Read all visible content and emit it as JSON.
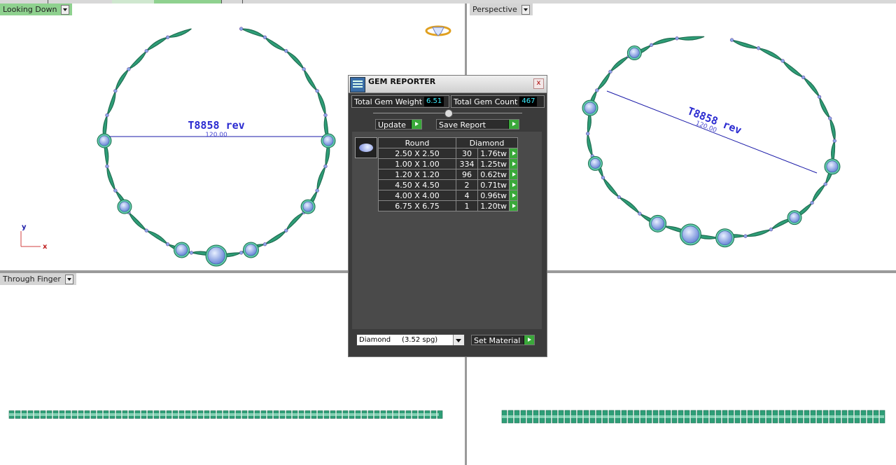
{
  "viewports": {
    "top_left": {
      "label": "Looking Down"
    },
    "top_right": {
      "label": "Perspective"
    },
    "bottom_left": {
      "label": "Through Finger"
    }
  },
  "annotation": {
    "name": "T8858 rev",
    "dimension": "120.00"
  },
  "axis": {
    "y": "y",
    "x": "x"
  },
  "gem_reporter": {
    "title": "GEM REPORTER",
    "close": "x",
    "total_weight_label": "Total Gem Weight",
    "total_weight_value": "6.51",
    "total_count_label": "Total Gem Count",
    "total_count_value": "467",
    "update_label": "Update",
    "save_report_label": "Save Report",
    "table_headers": {
      "shape": "Round",
      "material": "Diamond"
    },
    "rows": [
      {
        "size": "2.50 X 2.50",
        "count": "30",
        "carat": "1.76tw"
      },
      {
        "size": "1.00 X 1.00",
        "count": "334",
        "carat": "1.25tw"
      },
      {
        "size": "1.20 X 1.20",
        "count": "96",
        "carat": "0.62tw"
      },
      {
        "size": "4.50 X 4.50",
        "count": "2",
        "carat": "0.71tw"
      },
      {
        "size": "4.00 X 4.00",
        "count": "4",
        "carat": "0.96tw"
      },
      {
        "size": "6.75 X 6.75",
        "count": "1",
        "carat": "1.20tw"
      }
    ],
    "material_select": "Diamond     (3.52 spg)",
    "set_material_label": "Set Material"
  },
  "colors": {
    "metal": "#2e9e77",
    "metal_dark": "#1f6e52",
    "gem": "#8aa8e8",
    "dimension_line": "#1a1aa8",
    "active_viewport": "#8fd18f"
  }
}
